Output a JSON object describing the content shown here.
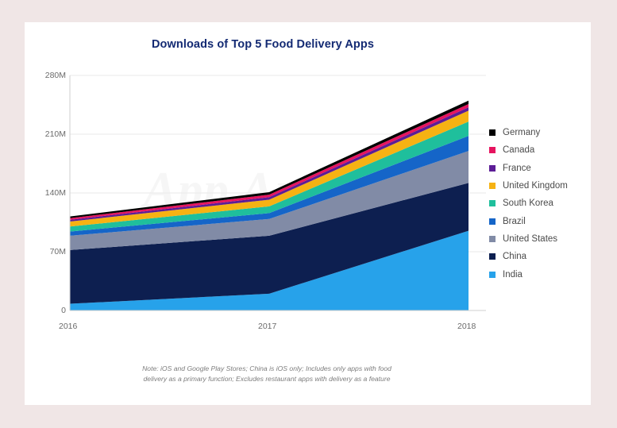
{
  "page": {
    "background_color": "#f0e6e6",
    "card_color": "#ffffff"
  },
  "chart_data": {
    "type": "area",
    "stacked": true,
    "title": "Downloads of Top 5 Food Delivery Apps",
    "xlabel": "",
    "ylabel": "",
    "categories": [
      "2016",
      "2017",
      "2018"
    ],
    "x_tick_labels": [
      "2016",
      "2017",
      "2018"
    ],
    "y_tick_labels": [
      "0",
      "70M",
      "140M",
      "210M",
      "280M"
    ],
    "y_tick_values": [
      0,
      70,
      140,
      210,
      280
    ],
    "ylim": [
      0,
      280
    ],
    "unit": "millions of downloads",
    "grid": true,
    "legend_position": "right",
    "watermark": "App Annie",
    "note": "Note: iOS and Google Play Stores; China is iOS only; Includes only apps with food delivery as a primary function; Excludes restaurant apps with delivery as a feature",
    "note_line1": "Note: iOS and Google Play Stores; China is iOS only; Includes only apps with food",
    "note_line2": "delivery as a primary function; Excludes restaurant apps with delivery as a feature",
    "stack_order_bottom_to_top": [
      "India",
      "China",
      "United States",
      "Brazil",
      "South Korea",
      "United Kingdom",
      "France",
      "Canada",
      "Germany"
    ],
    "series": [
      {
        "name": "India",
        "color": "#27a2ea",
        "values": [
          8,
          20,
          95
        ]
      },
      {
        "name": "China",
        "color": "#0d1f50",
        "values": [
          64,
          69,
          57
        ]
      },
      {
        "name": "United States",
        "color": "#818ba6",
        "values": [
          17,
          20,
          38
        ]
      },
      {
        "name": "Brazil",
        "color": "#1565c8",
        "values": [
          5,
          7,
          18
        ]
      },
      {
        "name": "South Korea",
        "color": "#1fbf9c",
        "values": [
          6,
          8,
          17
        ]
      },
      {
        "name": "United Kingdom",
        "color": "#f6b213",
        "values": [
          6,
          8,
          13
        ]
      },
      {
        "name": "France",
        "color": "#5c1d96",
        "values": [
          2,
          3,
          4
        ]
      },
      {
        "name": "Canada",
        "color": "#e6145f",
        "values": [
          2,
          3,
          4
        ]
      },
      {
        "name": "Germany",
        "color": "#000000",
        "values": [
          2,
          3,
          4
        ]
      }
    ],
    "totals": [
      112,
      141,
      250
    ]
  },
  "legend": {
    "items": [
      {
        "label": "Germany",
        "color": "#000000"
      },
      {
        "label": "Canada",
        "color": "#e6145f"
      },
      {
        "label": "France",
        "color": "#5c1d96"
      },
      {
        "label": "United Kingdom",
        "color": "#f6b213"
      },
      {
        "label": "South Korea",
        "color": "#1fbf9c"
      },
      {
        "label": "Brazil",
        "color": "#1565c8"
      },
      {
        "label": "United States",
        "color": "#818ba6"
      },
      {
        "label": "China",
        "color": "#0d1f50"
      },
      {
        "label": "India",
        "color": "#27a2ea"
      }
    ]
  }
}
